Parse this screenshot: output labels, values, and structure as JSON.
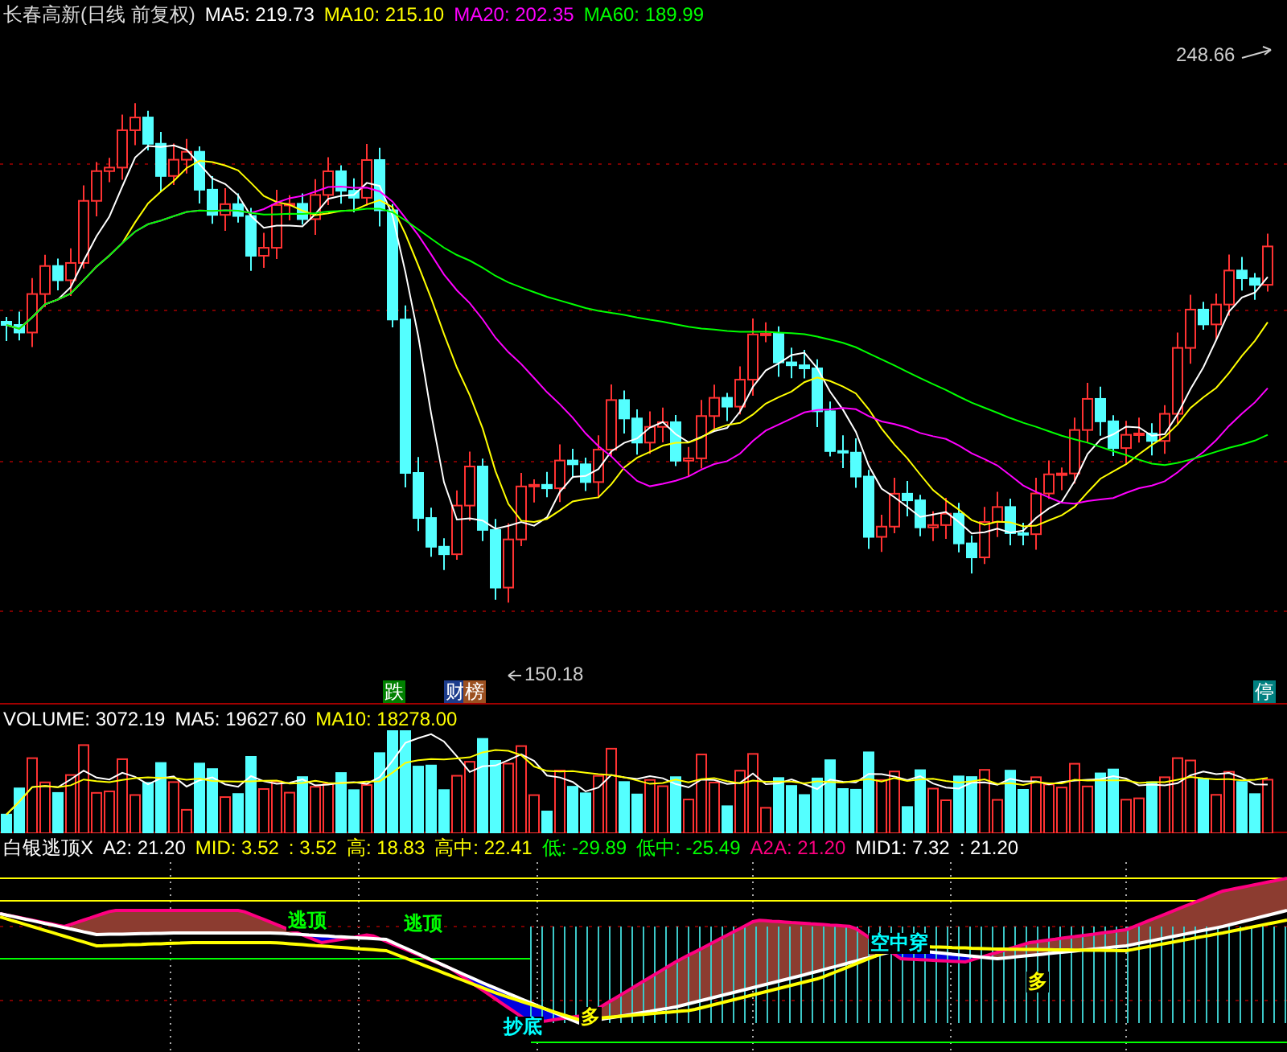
{
  "price_panel": {
    "title": "长春高新(日线 前复权)",
    "indicators": [
      {
        "label": "MA5: 219.73",
        "color": "#ffffff"
      },
      {
        "label": "MA10: 215.10",
        "color": "#ffff00"
      },
      {
        "label": "MA20: 202.35",
        "color": "#ff00ff"
      },
      {
        "label": "MA60: 189.99",
        "color": "#00ff00"
      }
    ],
    "high_marker": "248.66",
    "low_marker": "150.18",
    "badges": [
      {
        "text": "跌",
        "color": "#008000"
      },
      {
        "text": "财",
        "color": "#1c3c8c"
      },
      {
        "text": "榜",
        "color": "#9c5020"
      },
      {
        "text": "停",
        "color": "#008080"
      }
    ]
  },
  "volume_panel": {
    "indicators": [
      {
        "label": "VOLUME: 3072.19",
        "color": "#ffffff"
      },
      {
        "label": "MA5: 19627.60",
        "color": "#ffffff"
      },
      {
        "label": "MA10: 18278.00",
        "color": "#ffff00"
      }
    ]
  },
  "signal_panel": {
    "indicators": [
      {
        "label": "白银逃顶X",
        "color": "#ffffff"
      },
      {
        "label": "A2: 21.20",
        "color": "#ffffff"
      },
      {
        "label": "MID: 3.52",
        "color": "#ffff00"
      },
      {
        "label": ": 3.52",
        "color": "#ffff00"
      },
      {
        "label": "高: 18.83",
        "color": "#ffff00"
      },
      {
        "label": "高中: 22.41",
        "color": "#ffff00"
      },
      {
        "label": "低: -29.89",
        "color": "#00ff00"
      },
      {
        "label": "低中: -25.49",
        "color": "#00ff00"
      },
      {
        "label": "A2A: 21.20",
        "color": "#ff0080"
      },
      {
        "label": "MID1: 7.32",
        "color": "#ffffff"
      },
      {
        "label": ": 21.20",
        "color": "#ffffff"
      }
    ],
    "labels": [
      {
        "text": "逃顶",
        "color": "#00ff00"
      },
      {
        "text": "逃顶",
        "color": "#00ff00"
      },
      {
        "text": "抄底",
        "color": "#00ffff"
      },
      {
        "text": "空中穿",
        "color": "#00ffff"
      }
    ],
    "markers": [
      "多",
      "多"
    ]
  }
}
